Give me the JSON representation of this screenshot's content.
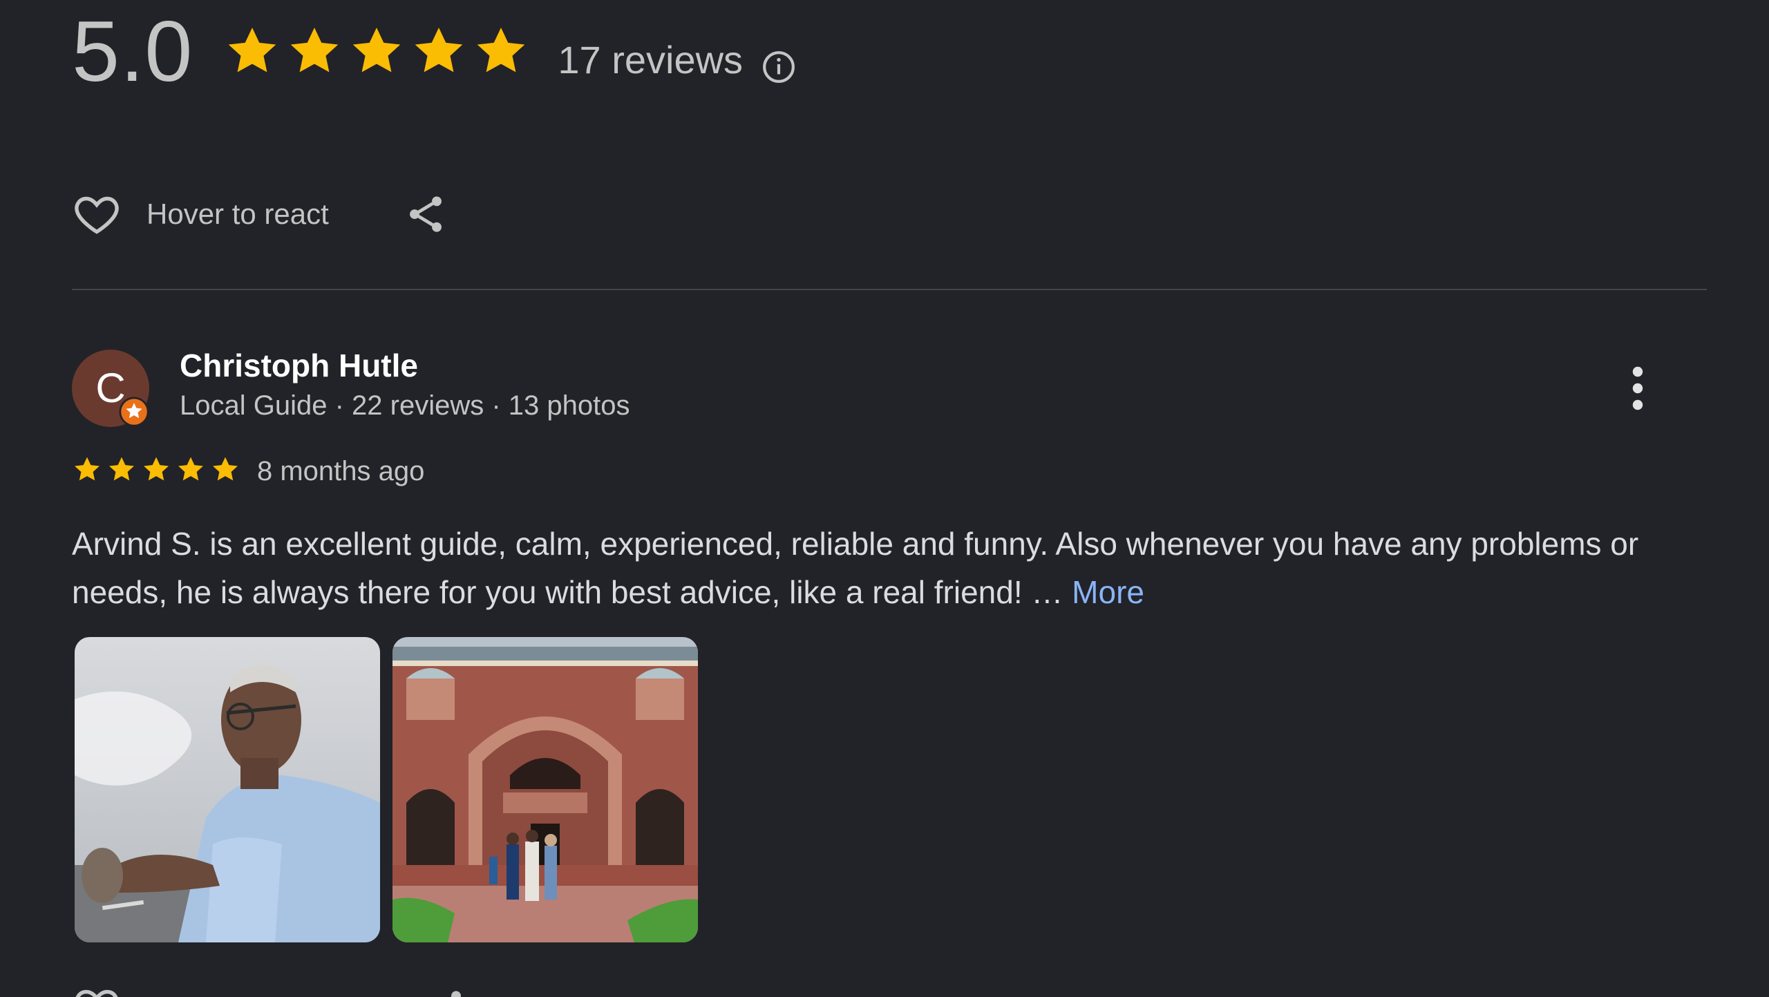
{
  "summary": {
    "score": "5.0",
    "stars": 5,
    "review_count": "17 reviews",
    "info_icon": "info-icon"
  },
  "actions": {
    "react_label": "Hover to react",
    "heart_icon": "heart-outline-icon",
    "share_icon": "share-icon"
  },
  "review": {
    "avatar_letter": "C",
    "avatar_color": "#6b3a2f",
    "badge_icon": "local-guide-star-icon",
    "badge_color": "#e8711a",
    "name": "Christoph Hutle",
    "meta": "Local Guide · 22 reviews · 13 photos",
    "stars": 5,
    "time": "8 months ago",
    "text": "Arvind S. is an excellent guide, calm, experienced, reliable and funny. Also whenever you have any problems or needs, he is always there for you with best advice, like a real friend! … ",
    "more_label": "More",
    "menu_icon": "more-vert-icon",
    "photos": [
      "review-photo-guide",
      "review-photo-monument"
    ]
  },
  "colors": {
    "background": "#222328",
    "star": "#fbbc04",
    "link": "#8ab4f8"
  }
}
